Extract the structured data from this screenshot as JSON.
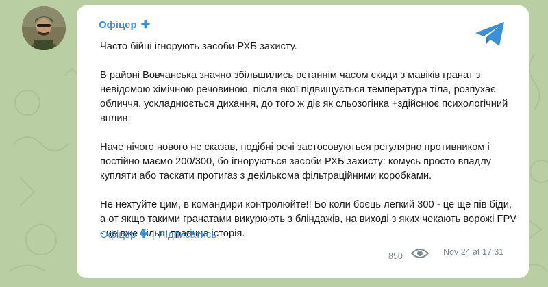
{
  "channel": {
    "name": "Офіцер",
    "verified_mark": "✚",
    "subscribe_label": "Підписатись"
  },
  "post": {
    "paragraphs": [
      "Часто бійці ігнорують засоби РХБ захисту.",
      "В районі Вовчанська значно збільшились останнім часом скиди з мавіків гранат з невідомою хімічною речовиною, після якої підвищується температура тіла, розпухає обличчя, ускладнюється дихання, до того ж діє як сльозогінка +здійснює психологічний вплив.",
      "Наче нічого нового не сказав, подібні речі застосовуються регулярно противником і постійно маємо 200/300, бо ігноруються засоби РХБ захисту: комусь просто впадлу купляти або таскати протигаз з декількома фільтраційними коробками.",
      "Не нехтуйте цим, в командири контролюйте!! Бо коли боєць легкий 300 - це ще пів біди, а от якщо такими гранатами викурюють з бліндажів, на виході з яких чекають ворожі FPV - це вже більш трагічна історія."
    ],
    "views": "850",
    "timestamp": "Nov 24 at 17:31"
  },
  "footer": {
    "separator": "|"
  },
  "icons": {
    "logo": "telegram-icon",
    "views": "eye-icon",
    "avatar": "channel-avatar"
  },
  "colors": {
    "background": "#b9cfa3",
    "accent": "#3b8fd6",
    "bubble": "#ffffff",
    "meta_text": "#7e8a93"
  }
}
